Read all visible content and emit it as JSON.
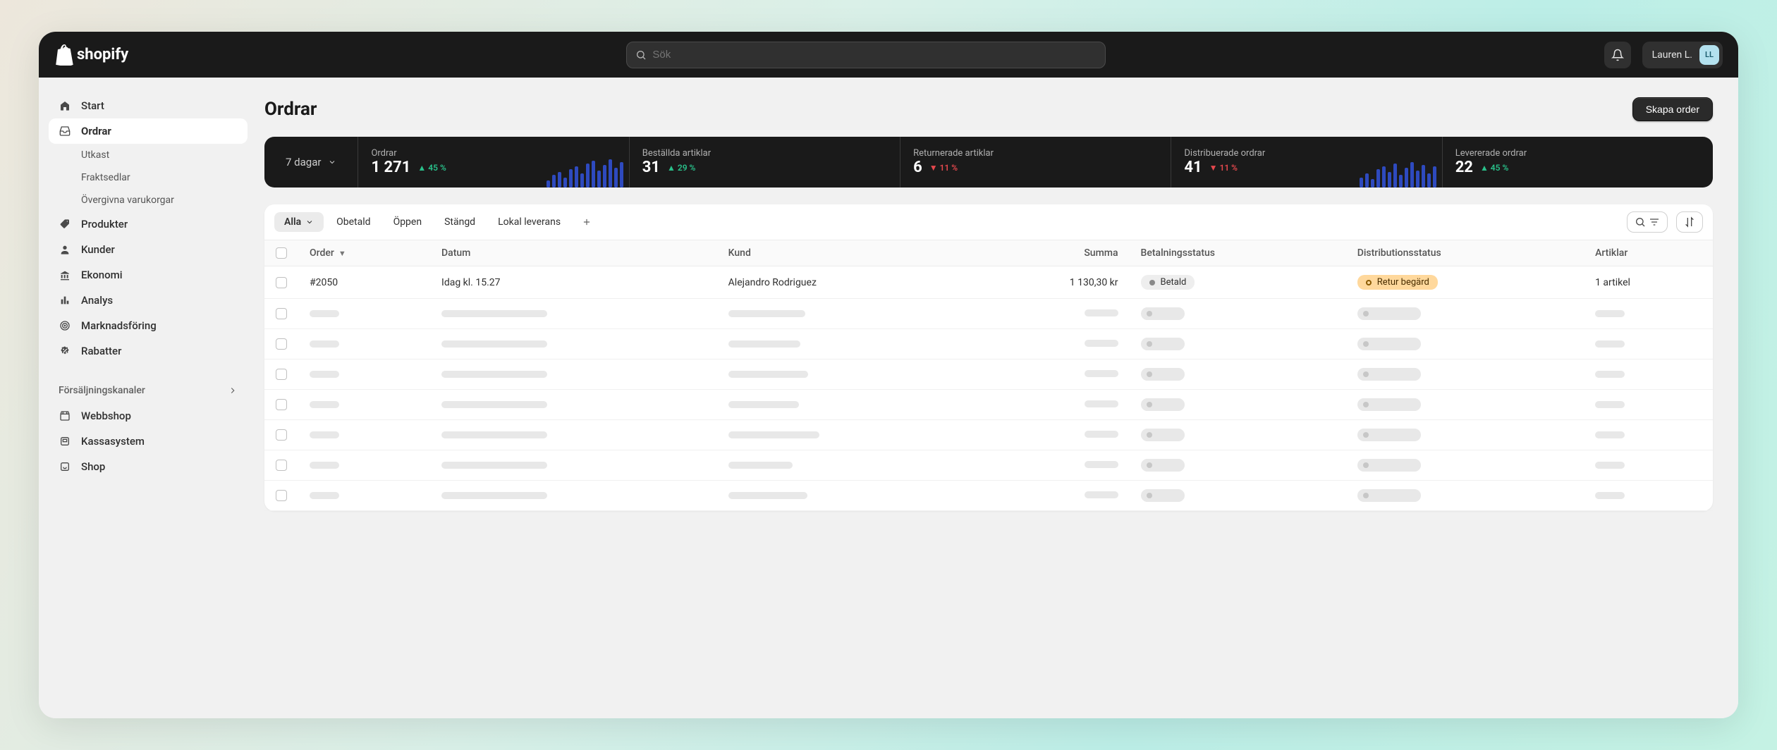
{
  "brand": "shopify",
  "search": {
    "placeholder": "Sök"
  },
  "user": {
    "name": "Lauren L.",
    "initials": "LL"
  },
  "sidebar": {
    "primary": [
      {
        "label": "Start"
      },
      {
        "label": "Ordrar",
        "active": true
      },
      {
        "label": "Produkter"
      },
      {
        "label": "Kunder"
      },
      {
        "label": "Ekonomi"
      },
      {
        "label": "Analys"
      },
      {
        "label": "Marknadsföring"
      },
      {
        "label": "Rabatter"
      }
    ],
    "orders_sub": [
      {
        "label": "Utkast"
      },
      {
        "label": "Fraktsedlar"
      },
      {
        "label": "Övergivna varukorgar"
      }
    ],
    "channels_header": "Försäljningskanaler",
    "channels": [
      {
        "label": "Webbshop"
      },
      {
        "label": "Kassasystem"
      },
      {
        "label": "Shop"
      }
    ]
  },
  "page": {
    "title": "Ordrar",
    "create_button": "Skapa order"
  },
  "stats": {
    "range": "7 dagar",
    "items": [
      {
        "label": "Ordrar",
        "value": "1 271",
        "delta": "45 %",
        "dir": "up",
        "spark": [
          10,
          18,
          22,
          14,
          26,
          30,
          20,
          34,
          38,
          24,
          32,
          40,
          28,
          36
        ]
      },
      {
        "label": "Beställda artiklar",
        "value": "31",
        "delta": "29 %",
        "dir": "up"
      },
      {
        "label": "Returnerade artiklar",
        "value": "6",
        "delta": "11 %",
        "dir": "down"
      },
      {
        "label": "Distribuerade ordrar",
        "value": "41",
        "delta": "11 %",
        "dir": "down",
        "spark": [
          14,
          20,
          12,
          26,
          30,
          22,
          34,
          18,
          28,
          36,
          24,
          32,
          20,
          30
        ]
      },
      {
        "label": "Levererade ordrar",
        "value": "22",
        "delta": "45 %",
        "dir": "up"
      }
    ]
  },
  "tabs": [
    "Alla",
    "Obetald",
    "Öppen",
    "Stängd",
    "Lokal leverans"
  ],
  "table": {
    "columns": [
      "Order",
      "Datum",
      "Kund",
      "Summa",
      "Betalningsstatus",
      "Distributionsstatus",
      "Artiklar"
    ],
    "row": {
      "order": "#2050",
      "date": "Idag kl. 15.27",
      "customer": "Alejandro Rodriguez",
      "total": "1 130,30 kr",
      "payment": "Betald",
      "fulfillment": "Retur begärd",
      "items": "1 artikel"
    },
    "placeholder_rows": 7
  }
}
